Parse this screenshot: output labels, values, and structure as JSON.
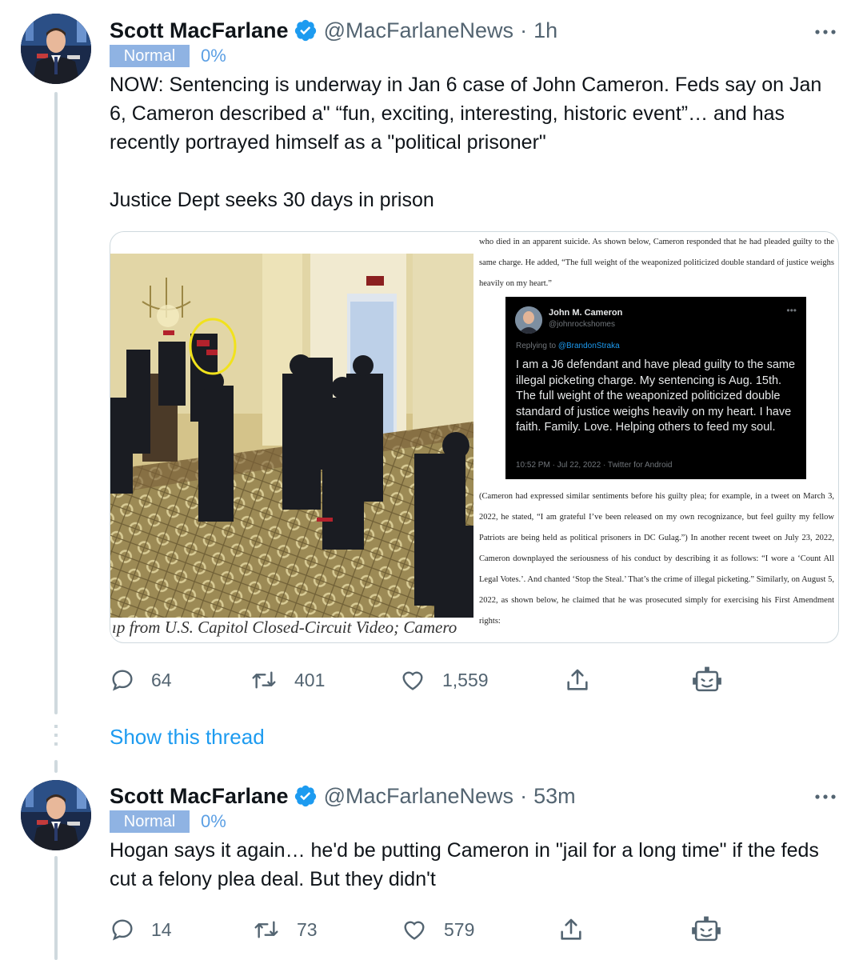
{
  "tweets": [
    {
      "display_name": "Scott MacFarlane",
      "handle": "@MacFarlaneNews",
      "separator": "·",
      "time": "1h",
      "badge": "Normal",
      "badge_pct": "0%",
      "text": [
        "NOW:  Sentencing is underway in Jan 6 case of John Cameron.  Feds say on Jan 6, Cameron described a\" “fun, exciting, interesting, historic event”… and has recently portrayed himself as a \"political prisoner\"",
        "Justice Dept seeks 30 days in prison"
      ],
      "media": {
        "caption": "ıp from U.S. Capitol Closed-Circuit Video; Camero",
        "doc_top": "who died in an apparent suicide. As shown below, Cameron responded that he had pleaded guilty to the same charge. He added, “The full weight of the weaponized politicized double standard of justice weighs heavily on my heart.”",
        "doc_bottom": "(Cameron had expressed similar sentiments before his guilty plea; for example, in a tweet on March 3, 2022, he stated, “I am grateful I’ve been released on my own recognizance, but feel guilty my fellow Patriots are being held as political prisoners in DC Gulag.”)  In another recent tweet on July 23, 2022, Cameron downplayed the seriousness of his conduct by describing it as follows: “I wore a ‘Count All Legal Votes.’. And chanted ‘Stop the Steal.’ That’s the crime of illegal picketing.” Similarly, on August 5, 2022, as shown below, he claimed that he was prosecuted simply for exercising his First Amendment rights:",
        "embedded_tweet": {
          "name": "John M. Cameron",
          "handle": "@johnrockshomes",
          "reply_prefix": "Replying to",
          "reply_to": "@BrandonStraka",
          "text": "I am a J6 defendant and have plead guilty to the same illegal picketing charge.  My sentencing is Aug. 15th.  The full weight of the weaponized politicized double standard of justice weighs heavily on my heart.  I have faith.  Family.  Love.  Helping others to feed my soul.",
          "meta": "10:52 PM · Jul 22, 2022 · Twitter for Android"
        }
      },
      "replies": "64",
      "retweets": "401",
      "likes": "1,559"
    },
    {
      "display_name": "Scott MacFarlane",
      "handle": "@MacFarlaneNews",
      "separator": "·",
      "time": "53m",
      "badge": "Normal",
      "badge_pct": "0%",
      "text": [
        "Hogan says it again… he'd be putting Cameron in \"jail for a long time\" if the feds cut a felony plea deal.  But they didn't"
      ],
      "replies": "14",
      "retweets": "73",
      "likes": "579"
    }
  ],
  "show_thread": "Show this thread",
  "icons": {
    "verified": "verified-badge-icon",
    "more": "more-horizontal-icon",
    "reply": "reply-bubble-icon",
    "retweet": "retweet-icon",
    "like": "heart-icon",
    "share": "share-upload-icon",
    "bot": "robot-icon"
  },
  "colors": {
    "accent": "#1d9bf0",
    "secondary_text": "#536471",
    "badge_bg": "#8fb3e3",
    "badge_pct": "#5b9fe4",
    "thread_line": "#cfd9de"
  }
}
